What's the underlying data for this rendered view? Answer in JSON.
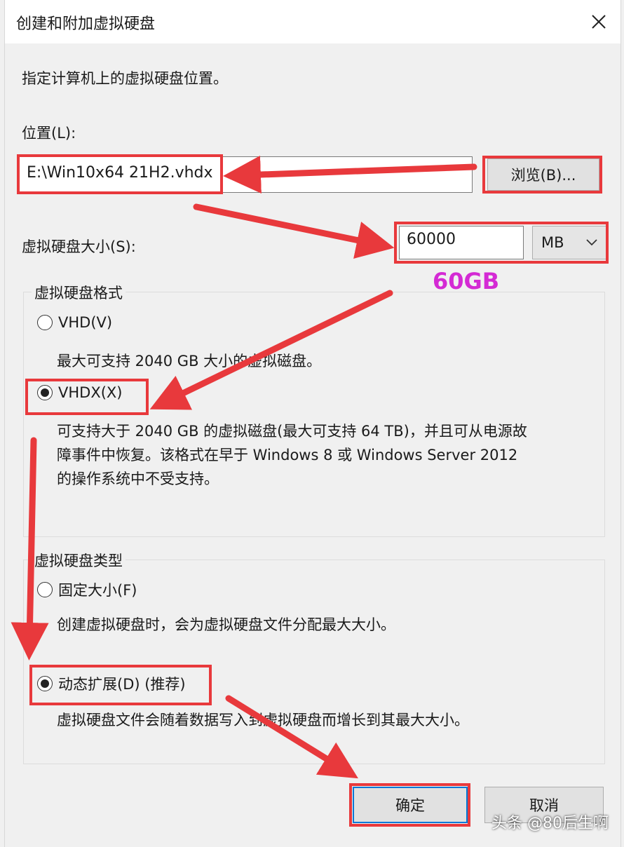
{
  "window": {
    "title": "创建和附加虚拟硬盘"
  },
  "intro": "指定计算机上的虚拟硬盘位置。",
  "location": {
    "label": "位置(L):",
    "value": "E:\\Win10x64 21H2.vhdx",
    "browse_label": "浏览(B)..."
  },
  "size": {
    "label": "虚拟硬盘大小(S):",
    "value": "60000",
    "unit": "MB",
    "note": "60GB"
  },
  "format_group": {
    "title": "虚拟硬盘格式",
    "options": [
      {
        "label": "VHD(V)",
        "selected": false,
        "desc": "最大可支持 2040 GB 大小的虚拟磁盘。"
      },
      {
        "label": "VHDX(X)",
        "selected": true,
        "desc_lines": [
          "可支持大于 2040 GB 的虚拟磁盘(最大可支持 64 TB)，并且可从电源故",
          "障事件中恢复。该格式在早于 Windows 8 或 Windows Server 2012",
          "的操作系统中不受支持。"
        ]
      }
    ]
  },
  "type_group": {
    "title": "虚拟硬盘类型",
    "options": [
      {
        "label": "固定大小(F)",
        "selected": false,
        "desc": "创建虚拟硬盘时，会为虚拟硬盘文件分配最大大小。"
      },
      {
        "label": "动态扩展(D) (推荐)",
        "selected": true,
        "desc": "虚拟硬盘文件会随着数据写入到虚拟硬盘而增长到其最大大小。"
      }
    ]
  },
  "buttons": {
    "ok": "确定",
    "cancel": "取消"
  },
  "watermark": "头条 @80后生啊",
  "colors": {
    "highlight": "#e8393c",
    "note": "#d42ad4",
    "accent": "#0078d7"
  }
}
